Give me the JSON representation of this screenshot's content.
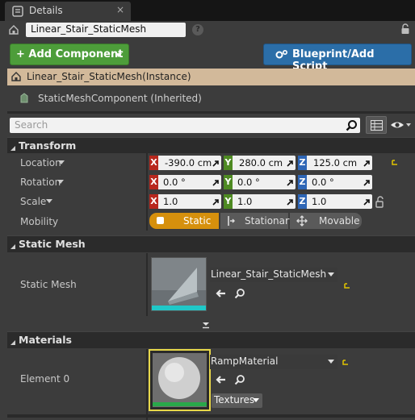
{
  "tab": {
    "title": "Details",
    "close": "×"
  },
  "header": {
    "actor_name": "Linear_Stair_StaticMesh",
    "help": "?"
  },
  "buttons": {
    "add_component": "+ Add Component",
    "blueprint": "Blueprint/Add Script"
  },
  "hierarchy": {
    "instance": "Linear_Stair_StaticMesh(Instance)",
    "component": "StaticMeshComponent (Inherited)"
  },
  "search": {
    "placeholder": "Search"
  },
  "transform": {
    "title": "Transform",
    "location_label": "Location",
    "rotation_label": "Rotation",
    "scale_label": "Scale",
    "mobility_label": "Mobility",
    "axis_x": "X",
    "axis_y": "Y",
    "axis_z": "Z",
    "location": [
      "-390.0 cm",
      "280.0 cm",
      "125.0 cm"
    ],
    "rotation": [
      "0.0 °",
      "0.0 °",
      "0.0 °"
    ],
    "scale": [
      "1.0",
      "1.0",
      "1.0"
    ],
    "mobility_options": [
      "Static",
      "Stationary",
      "Movable"
    ],
    "mobility_selected": "Static"
  },
  "static_mesh": {
    "title": "Static Mesh",
    "label": "Static Mesh",
    "value": "Linear_Stair_StaticMesh"
  },
  "materials": {
    "title": "Materials",
    "element_label": "Element 0",
    "value": "RampMaterial",
    "textures_label": "Textures"
  },
  "colors": {
    "add_green": "#4d9d3a",
    "blueprint_blue": "#2b6ea8",
    "static_selected": "#d6900d",
    "axis_x": "#b8281e",
    "axis_y": "#4e8a22",
    "axis_z": "#2e66b6"
  }
}
